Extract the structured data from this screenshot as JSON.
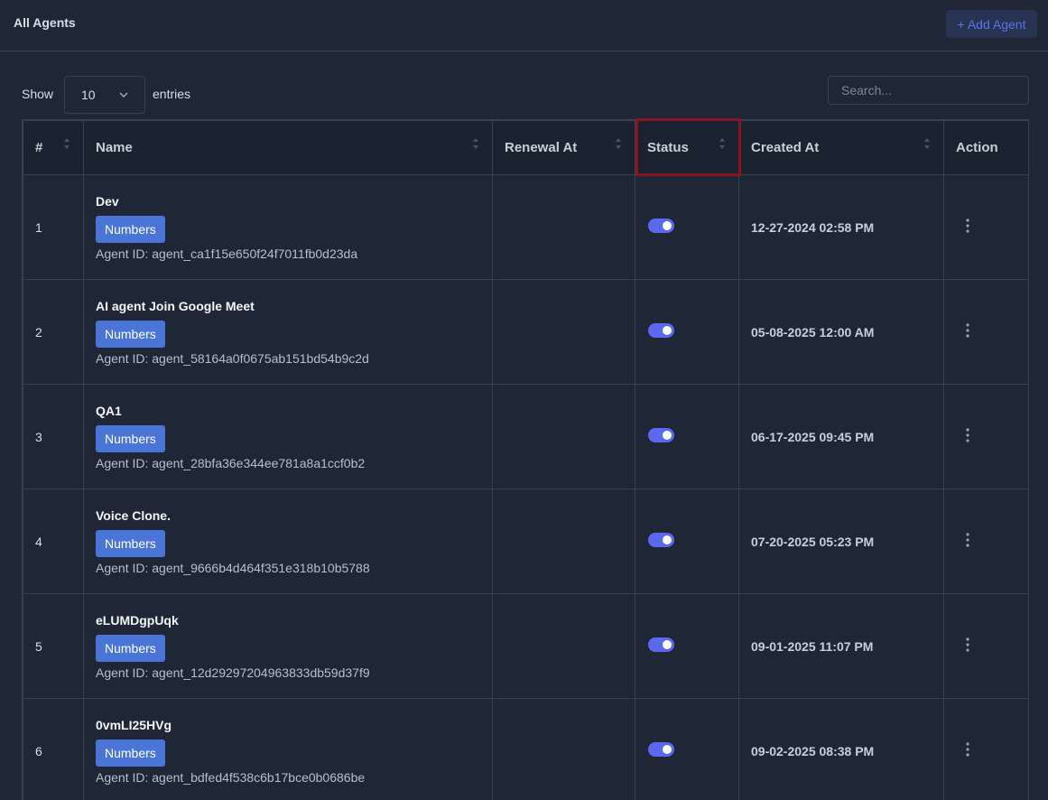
{
  "header": {
    "title": "All Agents",
    "add_button_label": "+ Add Agent"
  },
  "controls": {
    "show_label": "Show",
    "page_length": "10",
    "entries_label": "entries",
    "search_placeholder": "Search..."
  },
  "table": {
    "columns": [
      "#",
      "Name",
      "Renewal At",
      "Status",
      "Created At",
      "Action"
    ],
    "badge_label": "Numbers",
    "rows": [
      {
        "num": "1",
        "name": "Dev",
        "agent_id": "Agent ID: agent_ca1f15e650f24f7011fb0d23da",
        "renewal": "",
        "status": "on",
        "created": "12-27-2024 02:58 PM"
      },
      {
        "num": "2",
        "name": "AI agent Join Google Meet",
        "agent_id": "Agent ID: agent_58164a0f0675ab151bd54b9c2d",
        "renewal": "",
        "status": "on",
        "created": "05-08-2025 12:00 AM"
      },
      {
        "num": "3",
        "name": "QA1",
        "agent_id": "Agent ID: agent_28bfa36e344ee781a8a1ccf0b2",
        "renewal": "",
        "status": "on",
        "created": "06-17-2025 09:45 PM"
      },
      {
        "num": "4",
        "name": "Voice Clone.",
        "agent_id": "Agent ID: agent_9666b4d464f351e318b10b5788",
        "renewal": "",
        "status": "on",
        "created": "07-20-2025 05:23 PM"
      },
      {
        "num": "5",
        "name": "eLUMDgpUqk",
        "agent_id": "Agent ID: agent_12d29297204963833db59d37f9",
        "renewal": "",
        "status": "on",
        "created": "09-01-2025 11:07 PM"
      },
      {
        "num": "6",
        "name": "0vmLI25HVg",
        "agent_id": "Agent ID: agent_bdfed4f538c6b17bce0b0686be",
        "renewal": "",
        "status": "on",
        "created": "09-02-2025 08:38 PM"
      }
    ]
  },
  "colors": {
    "background": "#1f2736",
    "badge": "#4a74d6",
    "toggle_on": "#5b68f0",
    "accent_link": "#5b72ee",
    "highlight_box": "#8a1424"
  },
  "icons": {
    "sort": "sort-icon",
    "chevron": "chevron-down-icon",
    "kebab": "kebab-menu-icon"
  }
}
